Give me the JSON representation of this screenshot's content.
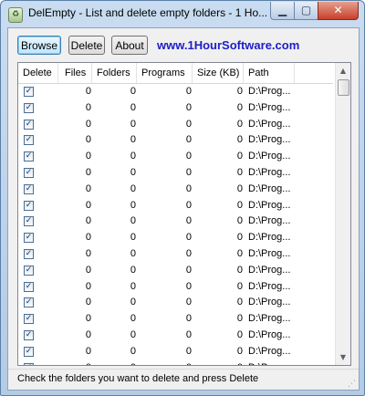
{
  "window": {
    "title": "DelEmpty - List and delete empty folders - 1 Ho...",
    "minimize_glyph": "▁",
    "maximize_glyph": "▢",
    "close_glyph": "✕"
  },
  "toolbar": {
    "browse_label": "Browse",
    "delete_label": "Delete",
    "about_label": "About",
    "website_link": "www.1HourSoftware.com"
  },
  "list": {
    "columns": [
      "Delete",
      "Files",
      "Folders",
      "Programs",
      "Size (KB)",
      "Path"
    ],
    "rows": [
      {
        "checked": true,
        "files": "0",
        "folders": "0",
        "programs": "0",
        "size": "0",
        "path": "D:\\Prog..."
      },
      {
        "checked": true,
        "files": "0",
        "folders": "0",
        "programs": "0",
        "size": "0",
        "path": "D:\\Prog..."
      },
      {
        "checked": true,
        "files": "0",
        "folders": "0",
        "programs": "0",
        "size": "0",
        "path": "D:\\Prog..."
      },
      {
        "checked": true,
        "files": "0",
        "folders": "0",
        "programs": "0",
        "size": "0",
        "path": "D:\\Prog..."
      },
      {
        "checked": true,
        "files": "0",
        "folders": "0",
        "programs": "0",
        "size": "0",
        "path": "D:\\Prog..."
      },
      {
        "checked": true,
        "files": "0",
        "folders": "0",
        "programs": "0",
        "size": "0",
        "path": "D:\\Prog..."
      },
      {
        "checked": true,
        "files": "0",
        "folders": "0",
        "programs": "0",
        "size": "0",
        "path": "D:\\Prog..."
      },
      {
        "checked": true,
        "files": "0",
        "folders": "0",
        "programs": "0",
        "size": "0",
        "path": "D:\\Prog..."
      },
      {
        "checked": true,
        "files": "0",
        "folders": "0",
        "programs": "0",
        "size": "0",
        "path": "D:\\Prog..."
      },
      {
        "checked": true,
        "files": "0",
        "folders": "0",
        "programs": "0",
        "size": "0",
        "path": "D:\\Prog..."
      },
      {
        "checked": true,
        "files": "0",
        "folders": "0",
        "programs": "0",
        "size": "0",
        "path": "D:\\Prog..."
      },
      {
        "checked": true,
        "files": "0",
        "folders": "0",
        "programs": "0",
        "size": "0",
        "path": "D:\\Prog..."
      },
      {
        "checked": true,
        "files": "0",
        "folders": "0",
        "programs": "0",
        "size": "0",
        "path": "D:\\Prog..."
      },
      {
        "checked": true,
        "files": "0",
        "folders": "0",
        "programs": "0",
        "size": "0",
        "path": "D:\\Prog..."
      },
      {
        "checked": true,
        "files": "0",
        "folders": "0",
        "programs": "0",
        "size": "0",
        "path": "D:\\Prog..."
      },
      {
        "checked": true,
        "files": "0",
        "folders": "0",
        "programs": "0",
        "size": "0",
        "path": "D:\\Prog..."
      },
      {
        "checked": true,
        "files": "0",
        "folders": "0",
        "programs": "0",
        "size": "0",
        "path": "D:\\Prog..."
      },
      {
        "checked": true,
        "files": "0",
        "folders": "0",
        "programs": "0",
        "size": "0",
        "path": "D:\\Prog..."
      }
    ]
  },
  "status": {
    "text": "Check the folders you want to delete and press Delete"
  },
  "colors": {
    "link": "#1d1dc8",
    "close_button": "#c7402b",
    "titlebar": "#c9dcf1"
  },
  "icons": [
    "app-icon",
    "checkbox-checked-icon",
    "scroll-up-icon",
    "scroll-down-icon",
    "size-grip-icon"
  ]
}
